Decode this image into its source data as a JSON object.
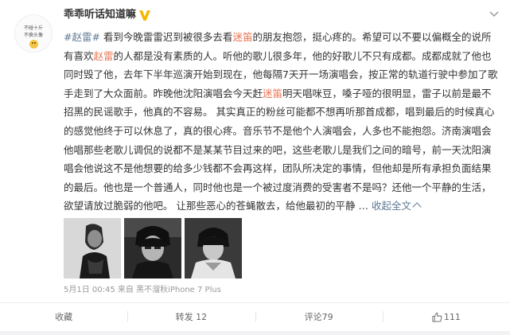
{
  "user": {
    "avatar_line1": "不碰十斤",
    "avatar_line2": "不换头像",
    "name": "乖乖听话知道嘛"
  },
  "post": {
    "hashtag": "#赵雷#",
    "s1": " 看到今晚雷雷迟到被很多去看",
    "mention1": "迷笛",
    "s2": "的朋友抱怨，挺心疼的。希望可以不要以偏概全的说所有喜欢",
    "mention2": "赵雷",
    "s3": "的人都是没有素质的人。听他的歌儿很多年，他的好歌儿不只有成都。成都成就了他也同时毁了他，去年下半年巡演开始到现在，他每隔7天开一场演唱会，按正常的轨道行驶中参加了歌手走到了大众面前。昨晚他沈阳演唱会今天赶",
    "mention3": "迷笛",
    "s4": "明天唱咪豆，嗓子哑的很明显，雷子以前是最不招黑的民谣歌手，他真的不容易。 其实真正的粉丝可能都不想再听那首成都，唱到最后的时候真心的感觉他终于可以休息了，真的很心疼。音乐节不是他个人演唱会，人多也不能抱怨。济南演唱会他唱那些老歌儿调侃的说都不是某某节目过来的吧，这些老歌儿是我们之间的暗号，前一天沈阳演唱会他说这不是他想要的给多少钱都不会再这样，团队所决定的事情，但他却是所有承担负面结果的最后。他也是一个普通人，同时他也是一个被过度消费的受害者不是吗？还他一个平静的生活，欲望请放过脆弱的他吧。 让那些恶心的苍蝇散去，给他最初的平静 …",
    "collapse": "收起全文",
    "meta": "5月1日 00:45 来自 黑不溜秋iPhone 7 Plus"
  },
  "actions": {
    "favorite": "收藏",
    "repost": "转发 12",
    "comment": "评论79",
    "like": "111"
  },
  "colors": {
    "highlight": "#eb7350",
    "link": "#5d7895",
    "verified": "#f5b700"
  }
}
